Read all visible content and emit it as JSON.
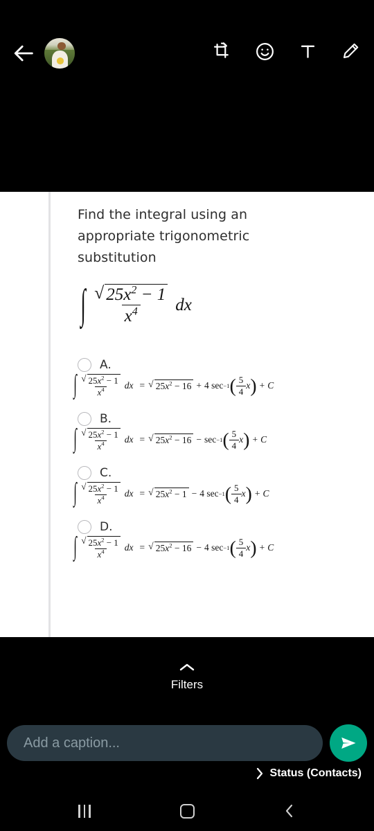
{
  "topbar": {
    "back_label": "Back",
    "back_icon": "arrow-left-icon",
    "avatar_label": "Profile photo",
    "tools": [
      {
        "name": "crop-rotate-icon",
        "label": "Crop / rotate"
      },
      {
        "name": "sticker-emoji-icon",
        "label": "Sticker"
      },
      {
        "name": "text-tool-icon",
        "label": "Text"
      },
      {
        "name": "draw-pen-icon",
        "label": "Draw"
      }
    ]
  },
  "content": {
    "question": "Find the integral using an appropriate trigonometric substitution",
    "integral": {
      "integral_symbol": "∫",
      "numerator_radicand": "25x2 − 1",
      "denominator": "x4",
      "differential": "dx"
    },
    "options": [
      {
        "letter": "A.",
        "lhs_radicand": "25x2 − 1",
        "lhs_den": "x4",
        "rhs_radicand": "25x2 − 16",
        "operator": "+",
        "coefficient": "4",
        "function": "sec",
        "exponent": "−1",
        "arg_num": "5",
        "arg_den": "4",
        "arg_var": "x",
        "constant": "+ C",
        "selected": false
      },
      {
        "letter": "B.",
        "lhs_radicand": "25x2 − 1",
        "lhs_den": "x4",
        "rhs_radicand": "25x2 − 16",
        "operator": "−",
        "coefficient": "",
        "function": "sec",
        "exponent": "−1",
        "arg_num": "5",
        "arg_den": "4",
        "arg_var": "x",
        "constant": "+ C",
        "selected": false
      },
      {
        "letter": "C.",
        "lhs_radicand": "25x2 − 1",
        "lhs_den": "x4",
        "rhs_radicand": "25x2 − 1",
        "operator": "−",
        "coefficient": "4",
        "function": "sec",
        "exponent": "−1",
        "arg_num": "5",
        "arg_den": "4",
        "arg_var": "x",
        "constant": "+ C",
        "selected": false
      },
      {
        "letter": "D.",
        "lhs_radicand": "25x2 − 1",
        "lhs_den": "x4",
        "rhs_radicand": "25x2 − 16",
        "operator": "−",
        "coefficient": "4",
        "function": "sec",
        "exponent": "−1",
        "arg_num": "5",
        "arg_den": "4",
        "arg_var": "x",
        "constant": "+ C",
        "selected": false
      }
    ]
  },
  "filters": {
    "label": "Filters",
    "chevron_icon": "chevron-up-icon"
  },
  "caption": {
    "placeholder": "Add a caption...",
    "value": "",
    "send_icon": "send-icon"
  },
  "status": {
    "label": "Status (Contacts)",
    "chevron_icon": "chevron-right-icon"
  },
  "navbar": {
    "recents_label": "Recents",
    "home_label": "Home",
    "back_label": "Back"
  },
  "colors": {
    "accent_teal": "#00a884",
    "caption_bg": "#2a3942",
    "background": "#000000",
    "sheet_bg": "#ffffff"
  }
}
